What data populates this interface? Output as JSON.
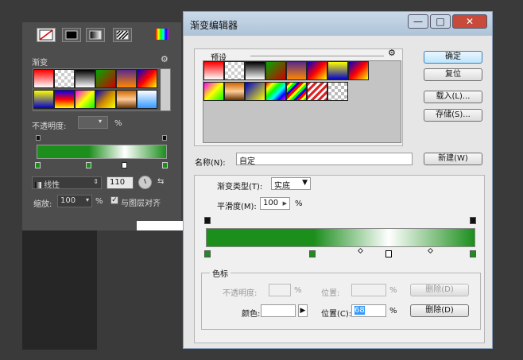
{
  "left_panel": {
    "section_title": "渐变",
    "opacity_label": "不透明度:",
    "opacity_unit": "%",
    "type_value": "线性",
    "angle_value": "110",
    "scale_label": "缩放:",
    "scale_value": "100",
    "scale_unit": "%",
    "align_label": "与图层对齐",
    "align_checked": true
  },
  "dialog": {
    "title": "渐变编辑器",
    "presets_label": "预设",
    "buttons": {
      "ok": "确定",
      "reset": "复位",
      "load": "载入(L)...",
      "save": "存储(S)...",
      "new": "新建(W)"
    },
    "name_label": "名称(N):",
    "name_value": "自定",
    "gradient_type_label": "渐变类型(T):",
    "gradient_type_value": "实底",
    "smoothness_label": "平滑度(M):",
    "smoothness_value": "100",
    "smoothness_unit": "%",
    "stops_group_title": "色标",
    "opacity_label": "不透明度:",
    "opacity_unit": "%",
    "opacity_location_label": "位置:",
    "opacity_location_unit": "%",
    "delete_disabled": "删除(D)",
    "color_label": "颜色:",
    "color_location_label": "位置(C):",
    "color_location_value": "68",
    "color_location_unit": "%",
    "delete": "删除(D)",
    "window_controls": {
      "minimize": "—",
      "maximize": "□",
      "close": "✕"
    }
  },
  "colors": {
    "accent_green": "#1c8e1c",
    "selection_blue": "#3399ff"
  }
}
